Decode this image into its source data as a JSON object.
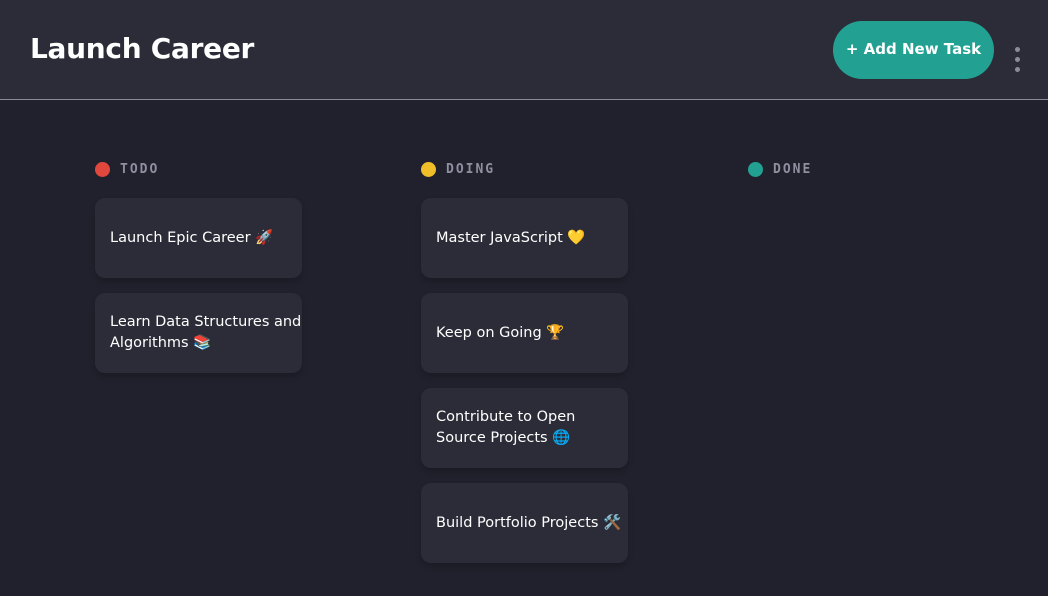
{
  "board": {
    "title": "Launch Career",
    "add_button_label": "+ Add New Task",
    "menu_icon": "kebab-menu-icon"
  },
  "columns": [
    {
      "name": "TODO",
      "color": "#e0483e",
      "tasks": [
        "Launch Epic Career 🚀",
        "Learn Data Structures and Algorithms 📚"
      ]
    },
    {
      "name": "DOING",
      "color": "#f0be29",
      "tasks": [
        "Master JavaScript 💛",
        "Keep on Going 🏆",
        "Contribute to Open Source Projects 🌐",
        "Build Portfolio Projects 🛠️"
      ]
    },
    {
      "name": "DONE",
      "color": "#22a193",
      "tasks": []
    }
  ]
}
